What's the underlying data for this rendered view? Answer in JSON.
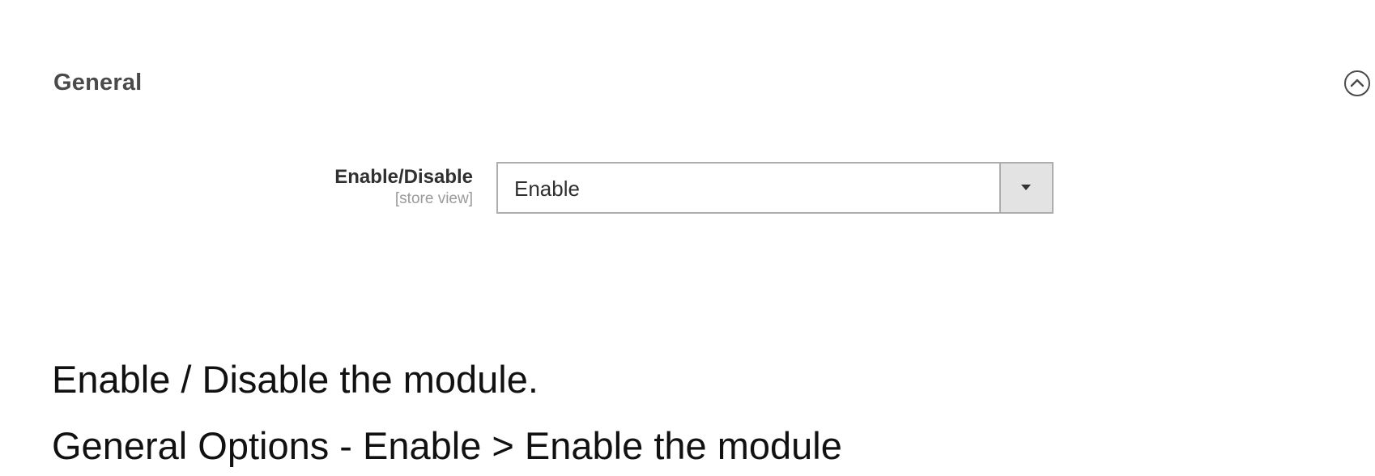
{
  "section": {
    "title": "General",
    "toggle_icon": "chevron-up-circle-icon"
  },
  "field": {
    "label": "Enable/Disable",
    "scope": "[store view]",
    "select": {
      "value": "Enable",
      "arrow_icon": "caret-down-icon"
    }
  },
  "description": {
    "line1": "Enable / Disable the module.",
    "line2": "General Options - Enable > Enable the module"
  }
}
